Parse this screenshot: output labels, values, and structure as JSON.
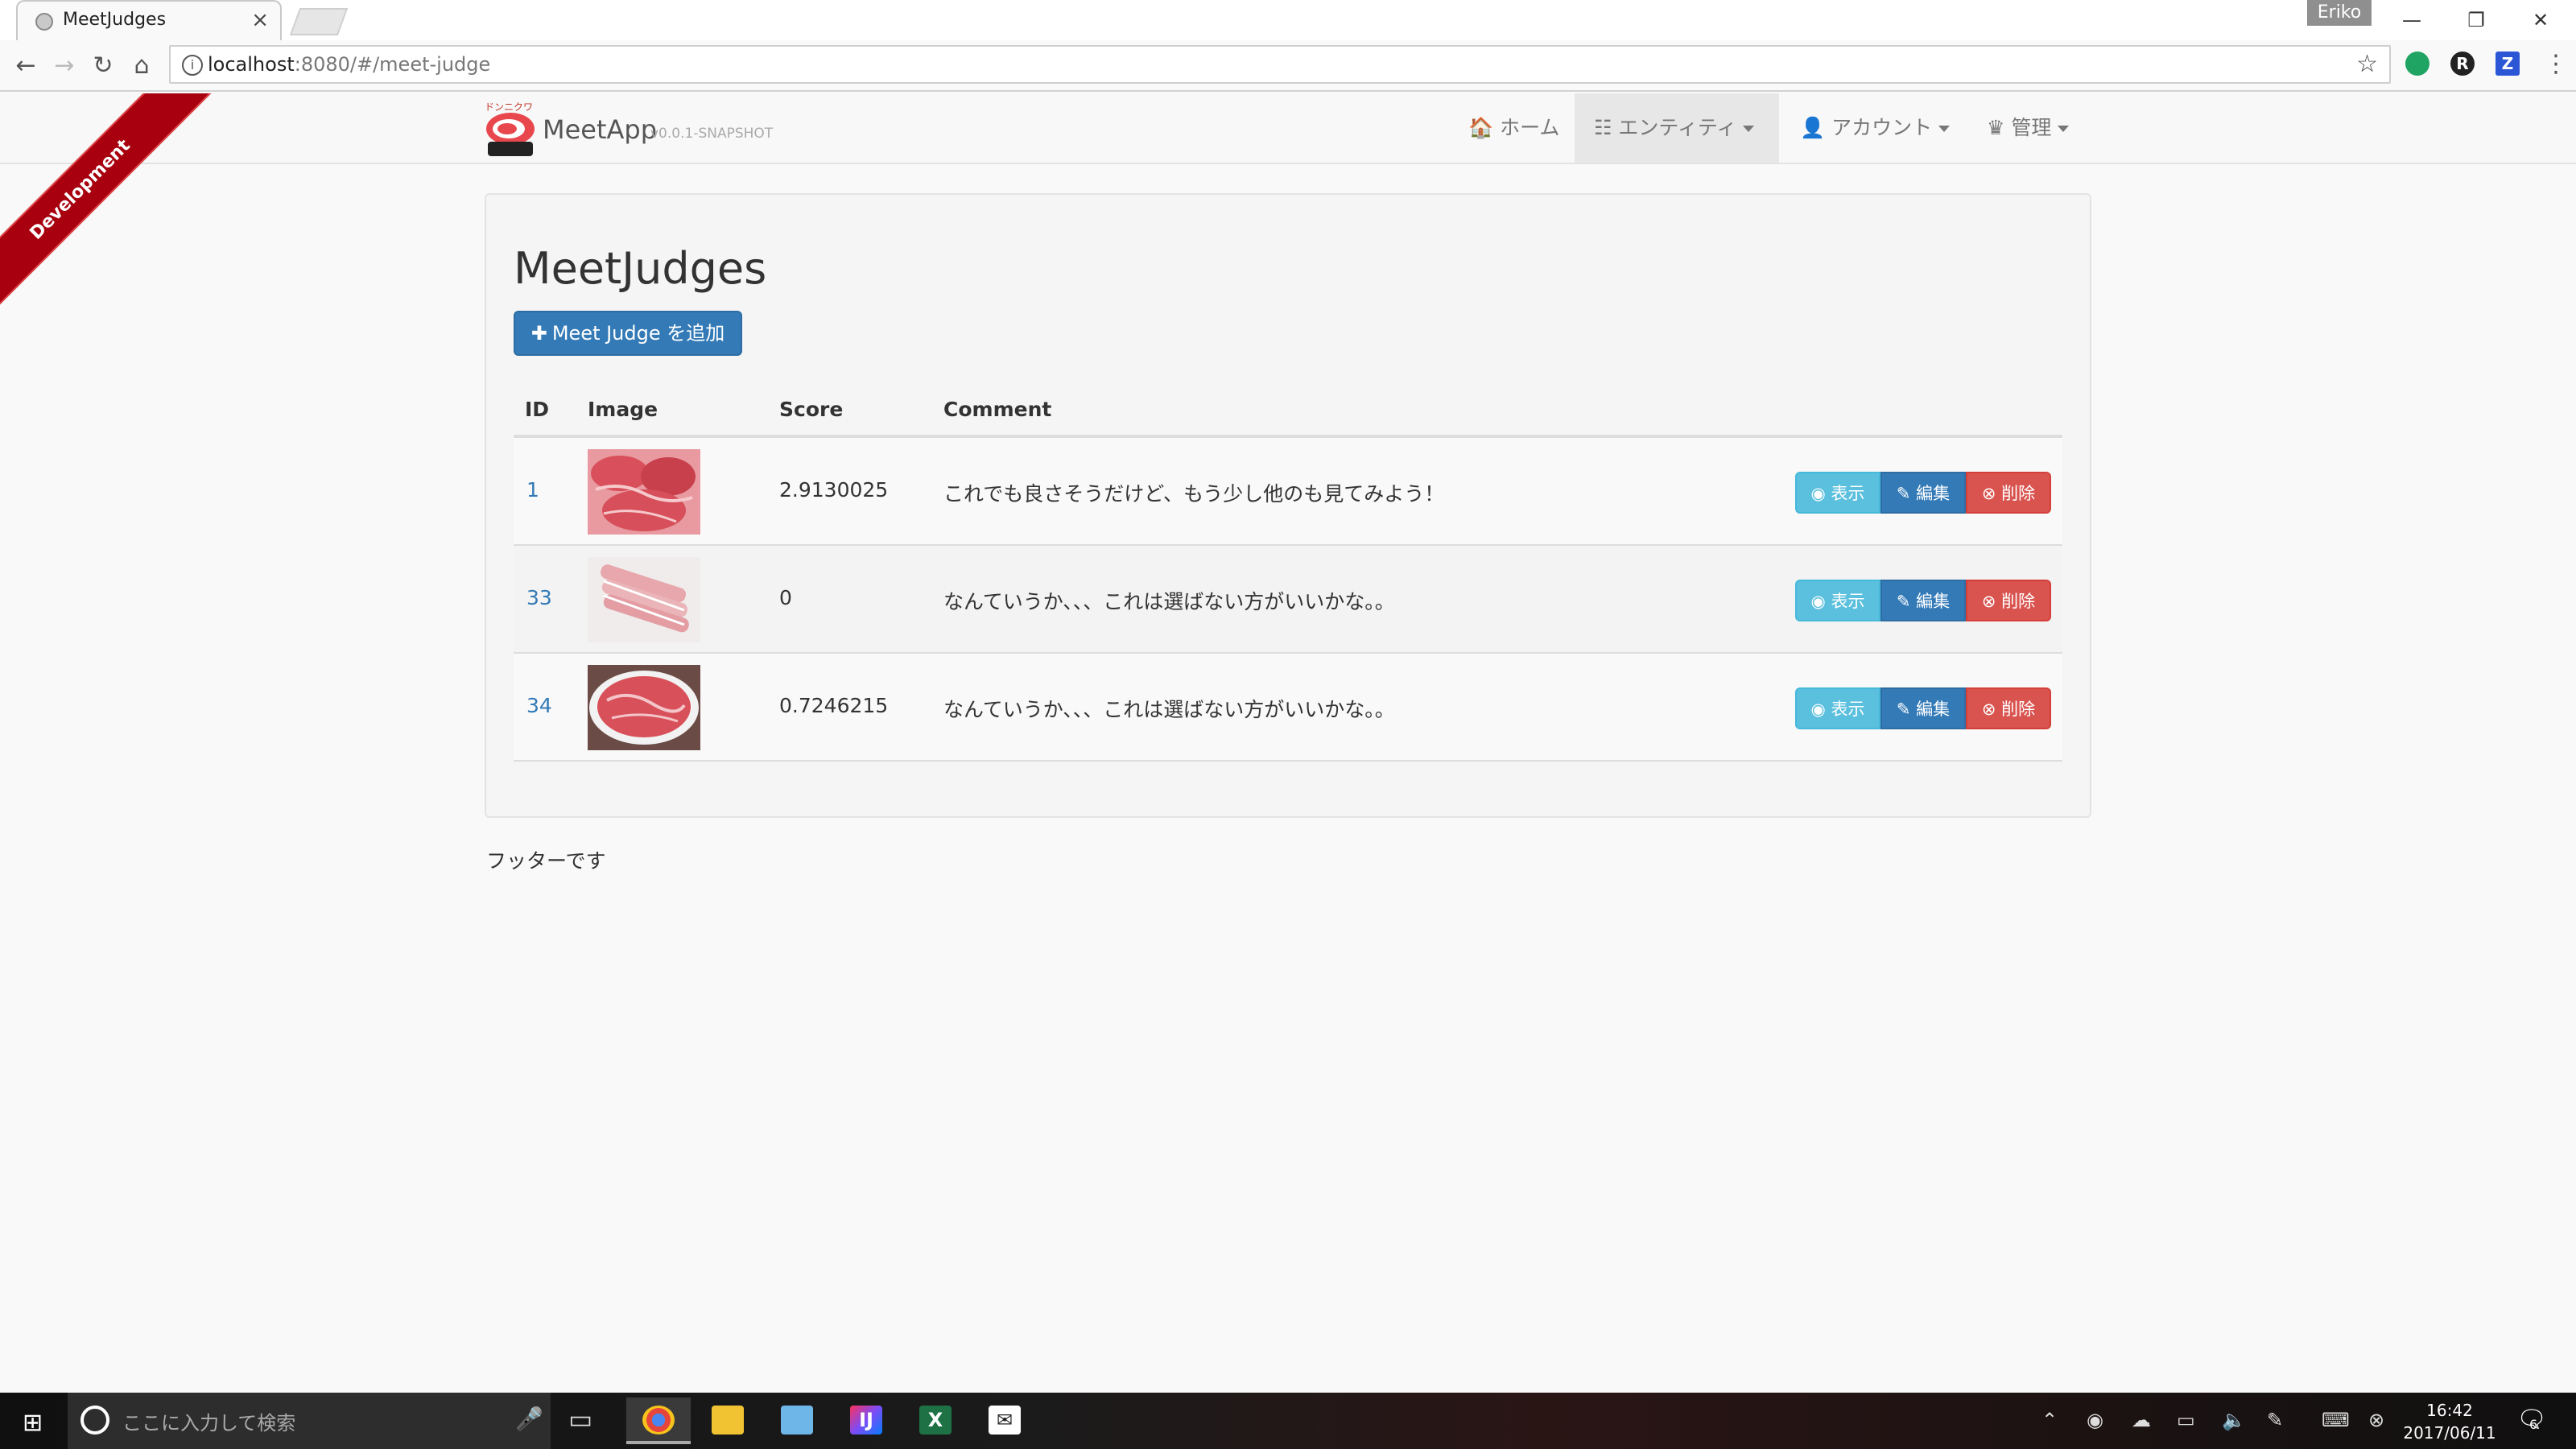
{
  "browser": {
    "tab_title": "MeetJudges",
    "tab_close": "×",
    "profile_name": "Eriko",
    "url_host": "localhost",
    "url_rest": ":8080/#/meet-judge",
    "win_minimize": "—",
    "win_restore": "❐",
    "win_close": "✕",
    "back": "←",
    "forward": "→",
    "reload": "↻",
    "home": "⌂",
    "star": "☆",
    "ext_r": "R",
    "ext_z": "Z",
    "menu": "⋮"
  },
  "navbar": {
    "logo_kana": "ドンニクワ",
    "brand": "MeetApp",
    "version": "v0.0.1-SNAPSHOT",
    "home_label": "🏠 ホーム",
    "entities_label": "☷ エンティティ",
    "account_label": "👤 アカウント",
    "admin_label": "♛ 管理"
  },
  "ribbon": {
    "label": "Development"
  },
  "page": {
    "title": "MeetJudges",
    "add_button": "Meet Judge を追加",
    "footer": "フッターです"
  },
  "table": {
    "headers": {
      "id": "ID",
      "image": "Image",
      "score": "Score",
      "comment": "Comment"
    },
    "rows": [
      {
        "id": "1",
        "score": "2.9130025",
        "comment": "これでも良さそうだけど、もう少し他のも見てみよう！",
        "view": "◉ 表示",
        "edit": "✎ 編集",
        "del": "⊗ 削除"
      },
      {
        "id": "33",
        "score": "0",
        "comment": "なんていうか、、、これは選ばない方がいいかな。。",
        "view": "◉ 表示",
        "edit": "✎ 編集",
        "del": "⊗ 削除"
      },
      {
        "id": "34",
        "score": "0.7246215",
        "comment": "なんていうか、、、これは選ばない方がいいかな。。",
        "view": "◉ 表示",
        "edit": "✎ 編集",
        "del": "⊗ 削除"
      }
    ]
  },
  "taskbar": {
    "start": "⊞",
    "search_placeholder": "ここに入力して検索",
    "mic": "🎤",
    "taskview": "▭",
    "apps": [
      "Chrome",
      "Explorer",
      "Photos",
      "IntelliJ",
      "Excel",
      "Mail"
    ],
    "clock_time": "16:42",
    "clock_date": "2017/06/11",
    "notifications": "6"
  }
}
